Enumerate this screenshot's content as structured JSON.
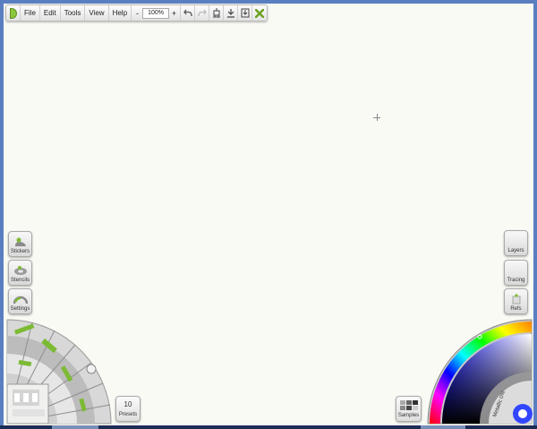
{
  "toolbar": {
    "menus": [
      "File",
      "Edit",
      "Tools",
      "View",
      "Help"
    ],
    "zoom_minus": "-",
    "zoom_value": "100%",
    "zoom_plus": "+"
  },
  "left_panel": {
    "stickers_label": "Stickers",
    "stencils_label": "Stencils",
    "settings_label": "Settings"
  },
  "right_panel": {
    "layers_label": "Layers",
    "tracing_label": "Tracing",
    "refs_label": "Refs"
  },
  "presets": {
    "count": "10",
    "label": "Presets"
  },
  "samples": {
    "label": "Samples"
  },
  "color_picker": {
    "metallic_label": "Metallic 0%"
  },
  "icons": {
    "logo": "artrage-logo-icon",
    "undo": "undo-icon",
    "redo": "redo-icon",
    "share": "share-icon",
    "export": "export-icon",
    "import": "import-icon",
    "close": "green-x-icon"
  },
  "colors": {
    "frame": "#5a7fc0",
    "canvas": "#fafaf5",
    "accent_green": "#8cc63f"
  }
}
